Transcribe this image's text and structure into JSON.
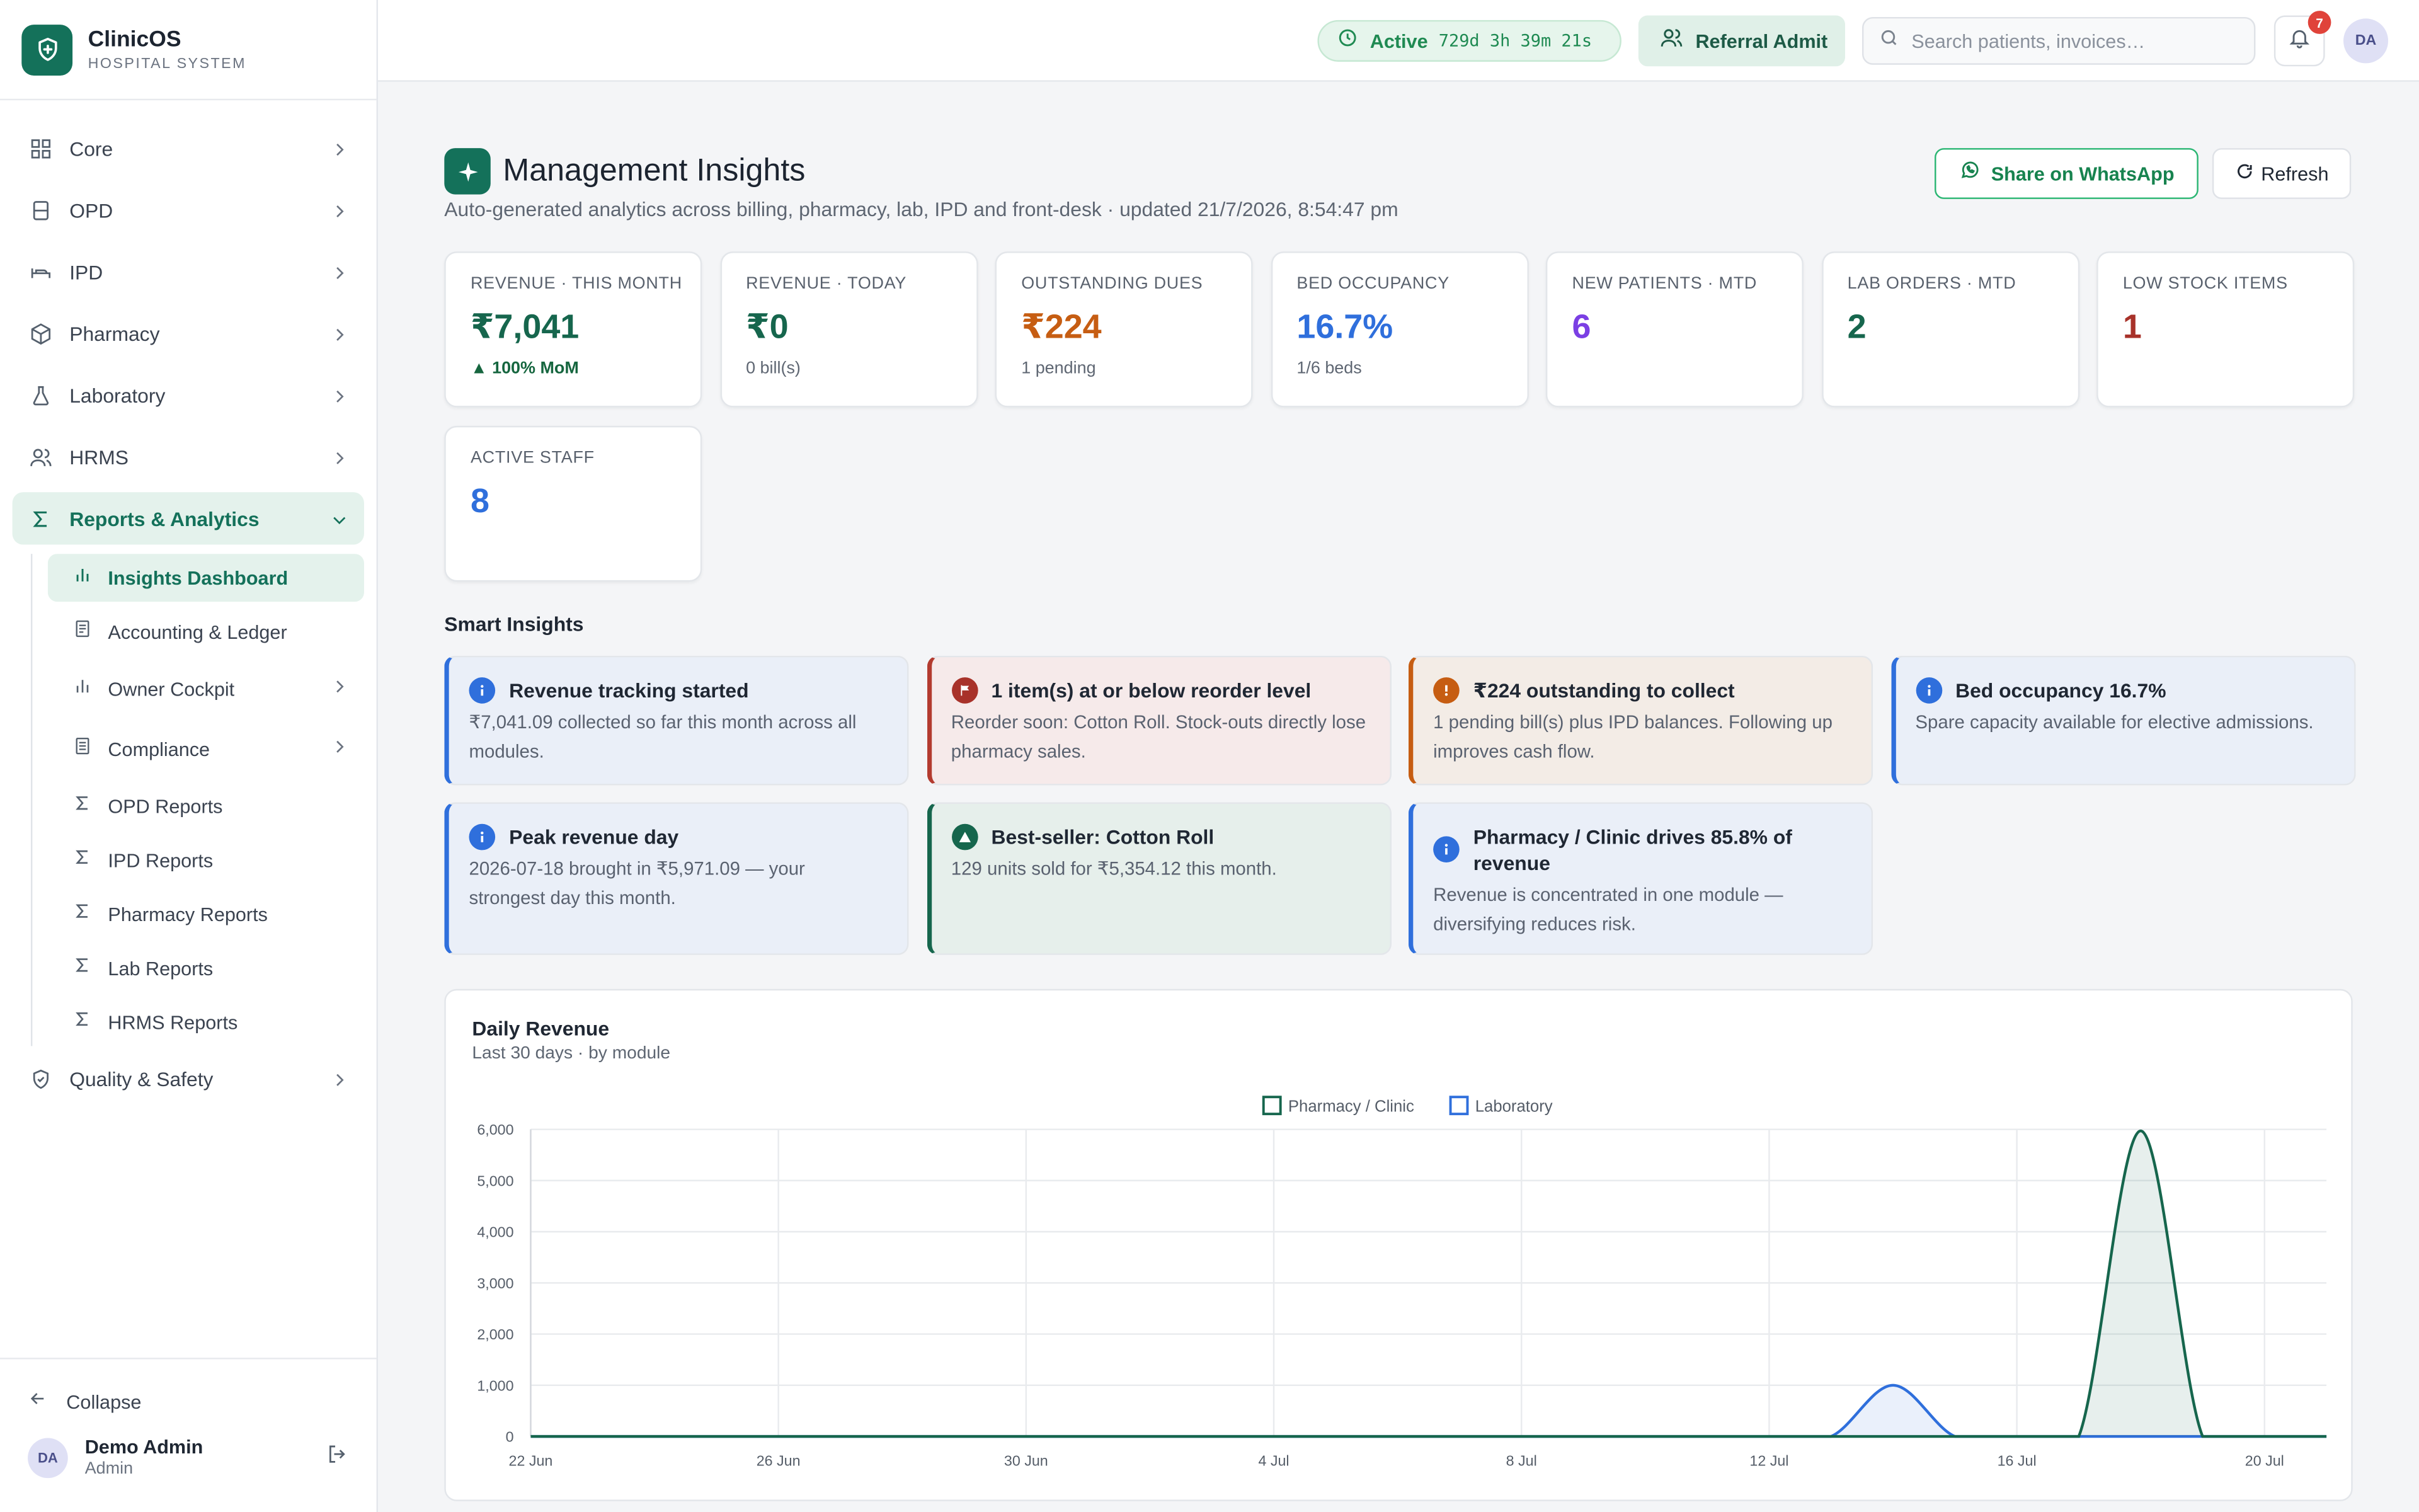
{
  "brand": {
    "name": "ClinicOS",
    "sub": "HOSPITAL SYSTEM"
  },
  "nav": {
    "core": "Core",
    "opd": "OPD",
    "ipd": "IPD",
    "pharmacy": "Pharmacy",
    "laboratory": "Laboratory",
    "hrms": "HRMS",
    "reports": "Reports & Analytics",
    "quality": "Quality & Safety"
  },
  "subnav": {
    "insights": "Insights Dashboard",
    "accounting": "Accounting & Ledger",
    "owner": "Owner Cockpit",
    "compliance": "Compliance",
    "opd_reports": "OPD Reports",
    "ipd_reports": "IPD Reports",
    "pharmacy_reports": "Pharmacy Reports",
    "lab_reports": "Lab Reports",
    "hrms_reports": "HRMS Reports"
  },
  "footer": {
    "collapse": "Collapse",
    "user_name": "Demo Admin",
    "user_role": "Admin",
    "user_initials": "DA"
  },
  "topbar": {
    "status_label": "Active",
    "uptime": "729d 3h 39m 21s",
    "referral_button": "Referral Admit",
    "search_placeholder": "Search patients, invoices…",
    "notifications": "7",
    "avatar_initials": "DA"
  },
  "page": {
    "title": "Management Insights",
    "subtitle": "Auto-generated analytics across billing, pharmacy, lab, IPD and front-desk · updated 21/7/2026, 8:54:47 pm",
    "share_button": "Share on WhatsApp",
    "refresh_button": "Refresh"
  },
  "kpis": {
    "revenue_month": {
      "label": "Revenue · This Month",
      "value": "₹7,041",
      "sub": "▲ 100% MoM",
      "color": "#16664d"
    },
    "revenue_today": {
      "label": "Revenue · Today",
      "value": "₹0",
      "sub": "0 bill(s)",
      "color": "#16664d"
    },
    "dues": {
      "label": "Outstanding Dues",
      "value": "₹224",
      "sub": "1 pending",
      "color": "#c65d12"
    },
    "bed": {
      "label": "Bed Occupancy",
      "value": "16.7%",
      "sub": "1/6 beds",
      "color": "#2f6fdc"
    },
    "new_patients": {
      "label": "New Patients · MTD",
      "value": "6",
      "color": "#7b3fe4"
    },
    "lab_orders": {
      "label": "Lab Orders · MTD",
      "value": "2",
      "color": "#16664d"
    },
    "low_stock": {
      "label": "Low Stock Items",
      "value": "1",
      "color": "#a8322a"
    },
    "active_staff": {
      "label": "Active Staff",
      "value": "8",
      "color": "#2f6fdc"
    }
  },
  "insights": {
    "title": "Smart Insights",
    "items": [
      {
        "title": "Revenue tracking started",
        "desc": "₹7,041.09 collected so far this month across all modules.",
        "kind": "info"
      },
      {
        "title": "1 item(s) at or below reorder level",
        "desc": "Reorder soon: Cotton Roll. Stock-outs directly lose pharmacy sales.",
        "kind": "warn"
      },
      {
        "title": "₹224 outstanding to collect",
        "desc": "1 pending bill(s) plus IPD balances. Following up improves cash flow.",
        "kind": "due"
      },
      {
        "title": "Bed occupancy 16.7%",
        "desc": "Spare capacity available for elective admissions.",
        "kind": "info"
      },
      {
        "title": "Peak revenue day",
        "desc": "2026-07-18 brought in ₹5,971.09 — your strongest day this month.",
        "kind": "info"
      },
      {
        "title": "Best-seller: Cotton Roll",
        "desc": "129 units sold for ₹5,354.12 this month.",
        "kind": "good"
      },
      {
        "title": "Pharmacy / Clinic drives 85.8% of revenue",
        "desc": "Revenue is concentrated in one module — diversifying reduces risk.",
        "kind": "info"
      }
    ]
  },
  "chart": {
    "title": "Daily Revenue",
    "subtitle": "Last 30 days · by module"
  },
  "chart_data": {
    "type": "area",
    "x": [
      "2026-06-22",
      "2026-06-23",
      "2026-06-24",
      "2026-06-25",
      "2026-06-26",
      "2026-06-27",
      "2026-06-28",
      "2026-06-29",
      "2026-06-30",
      "2026-07-01",
      "2026-07-02",
      "2026-07-03",
      "2026-07-04",
      "2026-07-05",
      "2026-07-06",
      "2026-07-07",
      "2026-07-08",
      "2026-07-09",
      "2026-07-10",
      "2026-07-11",
      "2026-07-12",
      "2026-07-13",
      "2026-07-14",
      "2026-07-15",
      "2026-07-16",
      "2026-07-17",
      "2026-07-18",
      "2026-07-19",
      "2026-07-20",
      "2026-07-21"
    ],
    "xticks": [
      "22 Jun",
      "26 Jun",
      "30 Jun",
      "4 Jul",
      "8 Jul",
      "12 Jul",
      "16 Jul",
      "20 Jul"
    ],
    "xtick_index": [
      0,
      4,
      8,
      12,
      16,
      20,
      24,
      28
    ],
    "series": [
      {
        "name": "Pharmacy / Clinic",
        "color": "#16664d",
        "fill": "rgba(22,102,77,0.10)",
        "values": [
          0,
          0,
          0,
          0,
          0,
          0,
          0,
          0,
          0,
          0,
          0,
          0,
          0,
          0,
          0,
          0,
          0,
          0,
          0,
          0,
          0,
          0,
          0,
          0,
          0,
          0,
          5971,
          0,
          0,
          0
        ]
      },
      {
        "name": "Laboratory",
        "color": "#2f6fdc",
        "fill": "rgba(47,111,220,0.10)",
        "values": [
          0,
          0,
          0,
          0,
          0,
          0,
          0,
          0,
          0,
          0,
          0,
          0,
          0,
          0,
          0,
          0,
          0,
          0,
          0,
          0,
          0,
          0,
          1000,
          0,
          0,
          0,
          0,
          0,
          0,
          0
        ]
      }
    ],
    "ylim": [
      0,
      6000
    ],
    "yticks": [
      0,
      1000,
      2000,
      3000,
      4000,
      5000,
      6000
    ],
    "ytick_labels": [
      "0",
      "1,000",
      "2,000",
      "3,000",
      "4,000",
      "5,000",
      "6,000"
    ],
    "legend": "top",
    "grid": true
  }
}
